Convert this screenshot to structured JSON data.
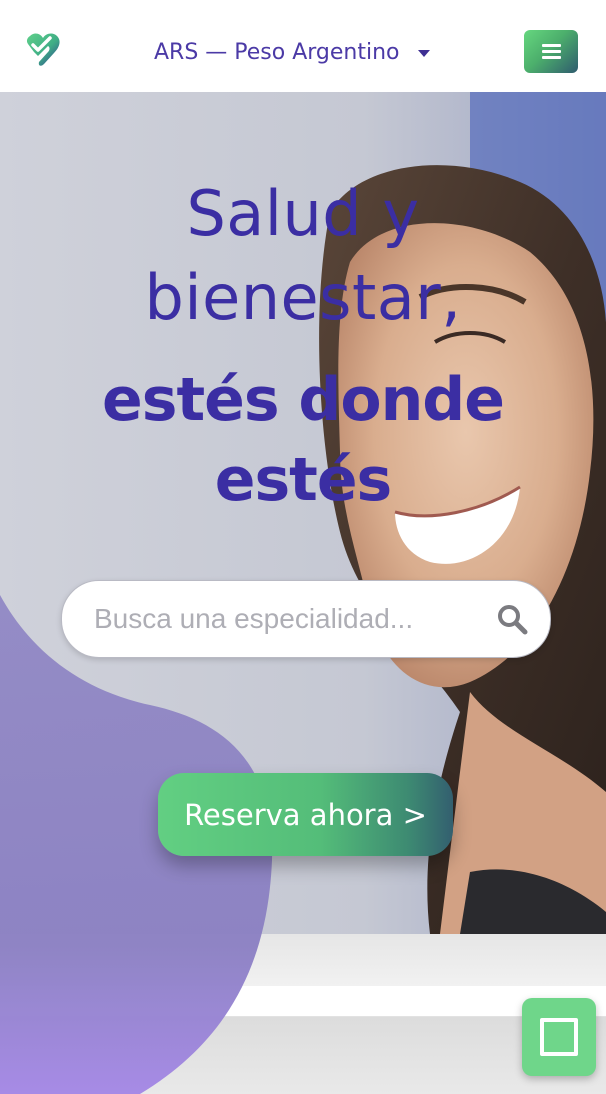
{
  "header": {
    "currency_label": "ARS — Peso Argentino",
    "logo_icon": "heart-check-logo",
    "menu_icon": "hamburger-icon"
  },
  "hero": {
    "title_line1": "Salud y",
    "title_line2": "bienestar,",
    "subtitle_line1": "estés donde",
    "subtitle_line2": "estés",
    "search_placeholder": "Busca una especialidad...",
    "cta_label": "Reserva ahora >"
  },
  "floating_button": {
    "icon": "square-icon"
  },
  "colors": {
    "brand_purple": "#3b2ea3",
    "brand_green": "#5ec97f",
    "brand_teal": "#2f5b6e",
    "blob_purple": "#8a7fc2"
  }
}
